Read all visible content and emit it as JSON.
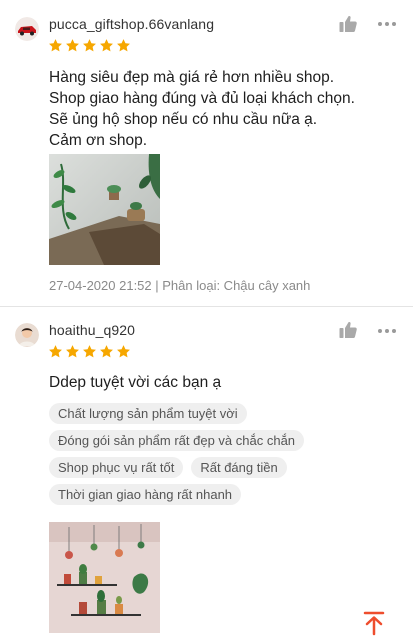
{
  "reviews": [
    {
      "username": "pucca_giftshop.66vanlang",
      "avatar_icon": "red-car-avatar",
      "rating": 5,
      "comment_lines": [
        "Hàng siêu đẹp mà giá rẻ hơn nhiều shop.",
        "Shop giao hàng đúng và đủ loại khách chọn.",
        "Sẽ ủng hộ shop nếu có nhu cầu nữa ạ.",
        "Cảm ơn shop."
      ],
      "meta": "27-04-2020 21:52 | Phân loại: Chậu cây xanh",
      "photo": "wall-plant-sticker-photo"
    },
    {
      "username": "hoaithu_q920",
      "avatar_icon": "person-avatar",
      "rating": 5,
      "comment_lines": [
        "Ddep tuyệt vời các bạn ạ"
      ],
      "tags": [
        [
          "Chất lượng sản phẩm tuyệt vời"
        ],
        [
          "Đóng gói sản phẩm rất đẹp và chắc chắn"
        ],
        [
          "Shop phục vụ rất tốt",
          "Rất đáng tiền"
        ],
        [
          "Thời gian giao hàng rất nhanh"
        ]
      ],
      "photo": "cactus-shelf-sticker-photo"
    }
  ],
  "icons": {
    "like": "thumbs-up-icon",
    "more": "more-options-icon",
    "scroll_top": "scroll-to-top-icon"
  },
  "colors": {
    "star": "#f6a700",
    "accent": "#ee4d2d",
    "tag_bg": "#efefef",
    "meta_text": "#8a8a8a"
  }
}
